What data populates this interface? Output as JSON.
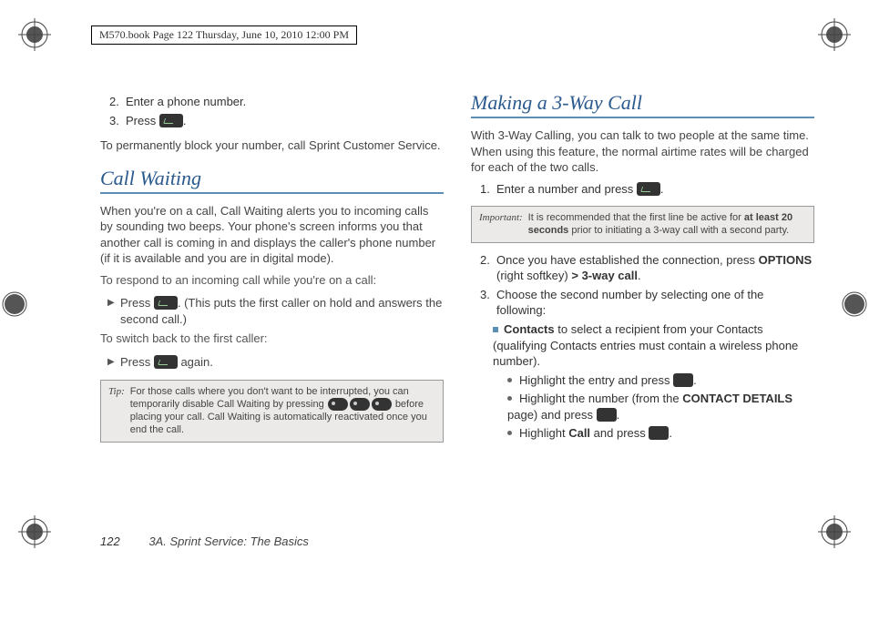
{
  "meta": {
    "header_text": "M570.book  Page 122  Thursday, June 10, 2010  12:00 PM"
  },
  "left": {
    "step2_num": "2.",
    "step2_text": "Enter a phone number.",
    "step3_num": "3.",
    "step3_pre": "Press ",
    "step3_post": ".",
    "block_text": "To permanently block your number, call Sprint Customer Service.",
    "h_callwaiting": "Call Waiting",
    "cw_intro": "When you're on a call, Call Waiting alerts you to incoming calls by sounding two beeps. Your phone's screen informs you that another call is coming in and displays the caller's phone number (if it is available and you are in digital mode).",
    "cw_respond": "To respond to an incoming call while you're on a call:",
    "cw_press_pre": "Press ",
    "cw_press_post": ". (This puts the first caller on hold and answers the second call.)",
    "cw_switch": "To switch back to the first caller:",
    "cw_again_pre": "Press ",
    "cw_again_post": " again.",
    "tip_label": "Tip:",
    "tip_body_a": "For those calls where you don't want to be interrupted, you can temporarily disable Call Waiting by pressing ",
    "tip_body_b": " before placing your call. Call Waiting is automatically reactivated once you end the call."
  },
  "right": {
    "h_3way": "Making a 3-Way Call",
    "intro": "With 3-Way Calling, you can talk to two people at the same time. When using this feature, the normal airtime rates will be charged for each of the two calls.",
    "s1_num": "1.",
    "s1_pre": "Enter a number and press ",
    "s1_post": ".",
    "imp_label": "Important:",
    "imp_pre": "It is recommended that the first line be active for ",
    "imp_bold": "at least 20 seconds",
    "imp_post": " prior to initiating a 3-way call with a second party.",
    "s2_num": "2.",
    "s2_pre": "Once you have established the connection, press ",
    "s2_opt": "OPTIONS",
    "s2_mid": " (right softkey) ",
    "s2_gt": ">",
    "s2_3way": " 3-way call",
    "s2_post": ".",
    "s3_num": "3.",
    "s3_text": "Choose the second number by selecting one of the following:",
    "b1_bold": "Contacts",
    "b1_text": " to select a recipient from your Contacts (qualifying Contacts entries must contain a wireless phone number).",
    "sb1_pre": "Highlight the entry and press ",
    "sb1_post": ".",
    "sb2_pre": "Highlight the number (from the ",
    "sb2_bold": "CONTACT DETAILS",
    "sb2_mid": " page) and press ",
    "sb2_post": ".",
    "sb3_pre": "Highlight ",
    "sb3_bold": "Call",
    "sb3_mid": " and press ",
    "sb3_post": "."
  },
  "footer": {
    "page": "122",
    "chapter": "3A. Sprint Service: The Basics"
  }
}
